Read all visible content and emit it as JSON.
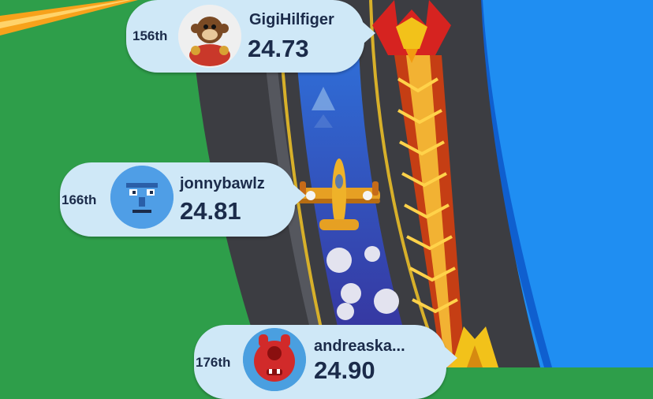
{
  "leaderboard": [
    {
      "rank": "156th",
      "name": "GigiHilfiger",
      "time": "24.73",
      "avatar_icon": "monkey-toy-icon"
    },
    {
      "rank": "166th",
      "name": "jonnybawlz",
      "time": "24.81",
      "avatar_icon": "pixel-face-icon"
    },
    {
      "rank": "176th",
      "name": "andreaska...",
      "time": "24.90",
      "avatar_icon": "red-monster-icon"
    }
  ],
  "colors": {
    "grass": "#2e9e4a",
    "water": "#1f8ef2",
    "track": "#3c3d42",
    "bubble": "#cfe8f7",
    "text": "#1b2b4a"
  }
}
